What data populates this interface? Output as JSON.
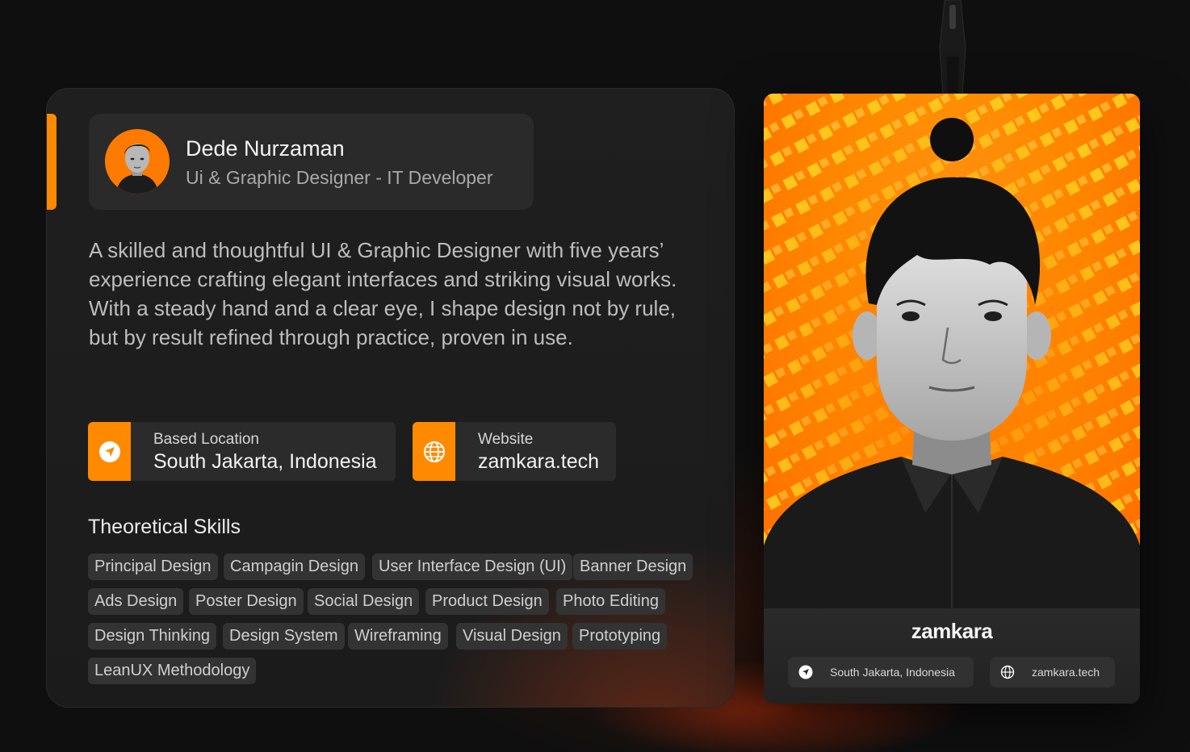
{
  "profile": {
    "name": "Dede Nurzaman",
    "role": "Ui & Graphic Designer - IT Developer",
    "bio": "A skilled and thoughtful UI & Graphic Designer with five years’ experience crafting elegant interfaces and striking visual works. With a steady hand and a clear eye, I shape design not by rule, but by result refined through practice, proven in use."
  },
  "info": {
    "location_label": "Based Location",
    "location_value": "South Jakarta, Indonesia",
    "website_label": "Website",
    "website_value": "zamkara.tech"
  },
  "skills": {
    "title": "Theoretical Skills",
    "items": [
      "Principal Design",
      "Campagin Design",
      "User Interface Design (UI)",
      "Banner Design",
      "Ads Design",
      "Poster Design",
      "Social Design",
      "Product Design",
      "Photo Editing",
      "Design Thinking",
      "Design System",
      "Wireframing",
      "Visual Design",
      "Prototyping",
      "LeanUX Methodology"
    ]
  },
  "badge": {
    "brand": "zamkara",
    "location": "South Jakarta, Indonesia",
    "website": "zamkara.tech"
  },
  "colors": {
    "accent": "#ff8a00",
    "background": "#0f0f0f",
    "card": "#1f1f1f",
    "chip": "#333333"
  },
  "icons": {
    "location": "navigation-arrow-icon",
    "website": "globe-icon"
  }
}
